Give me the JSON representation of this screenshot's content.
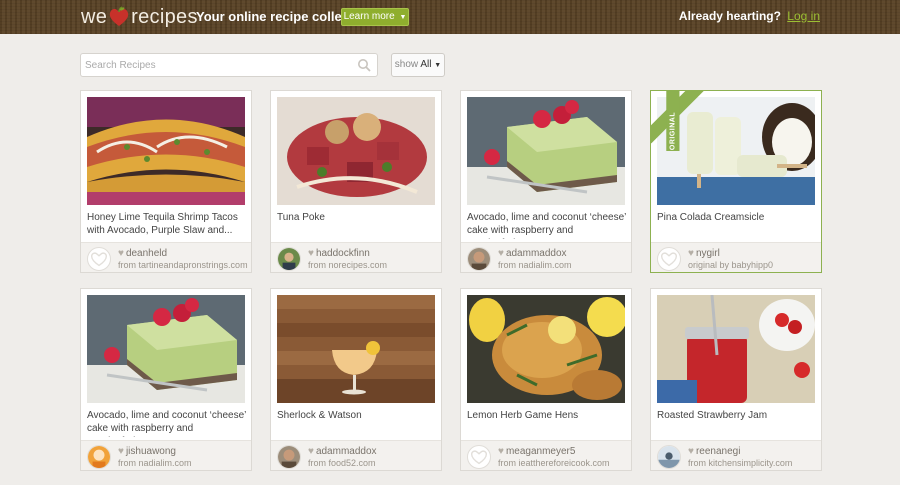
{
  "header": {
    "logo_we": "we",
    "logo_recipes": "recipes",
    "tagline": "Your online recipe collection",
    "learn_more": "Learn more",
    "already_hearting": "Already hearting?",
    "login": "Log in"
  },
  "search": {
    "placeholder": "Search Recipes"
  },
  "filter": {
    "show_label": "show",
    "show_value": "All"
  },
  "colors": {
    "accent": "#8fae2e",
    "header_brown": "#5a4326",
    "heart_red": "#c8312a"
  },
  "cards": [
    {
      "title": "Honey Lime Tequila Shrimp Tacos with Avocado, Purple Slaw and...",
      "user": "deanheld",
      "source": "from tartineandapronstrings.com"
    },
    {
      "title": "Tuna Poke",
      "user": "haddockfinn",
      "source": "from norecipes.com"
    },
    {
      "title": "Avocado, lime and coconut ‘cheese’ cake with raspberry and passionfruit",
      "user": "adammaddox",
      "source": "from nadialim.com"
    },
    {
      "title": "Pina Colada Creamsicle",
      "user": "nygirl",
      "source": "original by babyhipp0",
      "badge": "ORIGINAL"
    },
    {
      "title": "Avocado, lime and coconut ‘cheese’ cake with raspberry and passionfruit",
      "user": "jishuawong",
      "source": "from nadialim.com"
    },
    {
      "title": "Sherlock & Watson",
      "user": "adammaddox",
      "source": "from food52.com"
    },
    {
      "title": "Lemon Herb Game Hens",
      "user": "meaganmeyer5",
      "source": "from ieatthereforeicook.com"
    },
    {
      "title": "Roasted Strawberry Jam",
      "user": "reenanegi",
      "source": "from kitchensimplicity.com"
    }
  ]
}
